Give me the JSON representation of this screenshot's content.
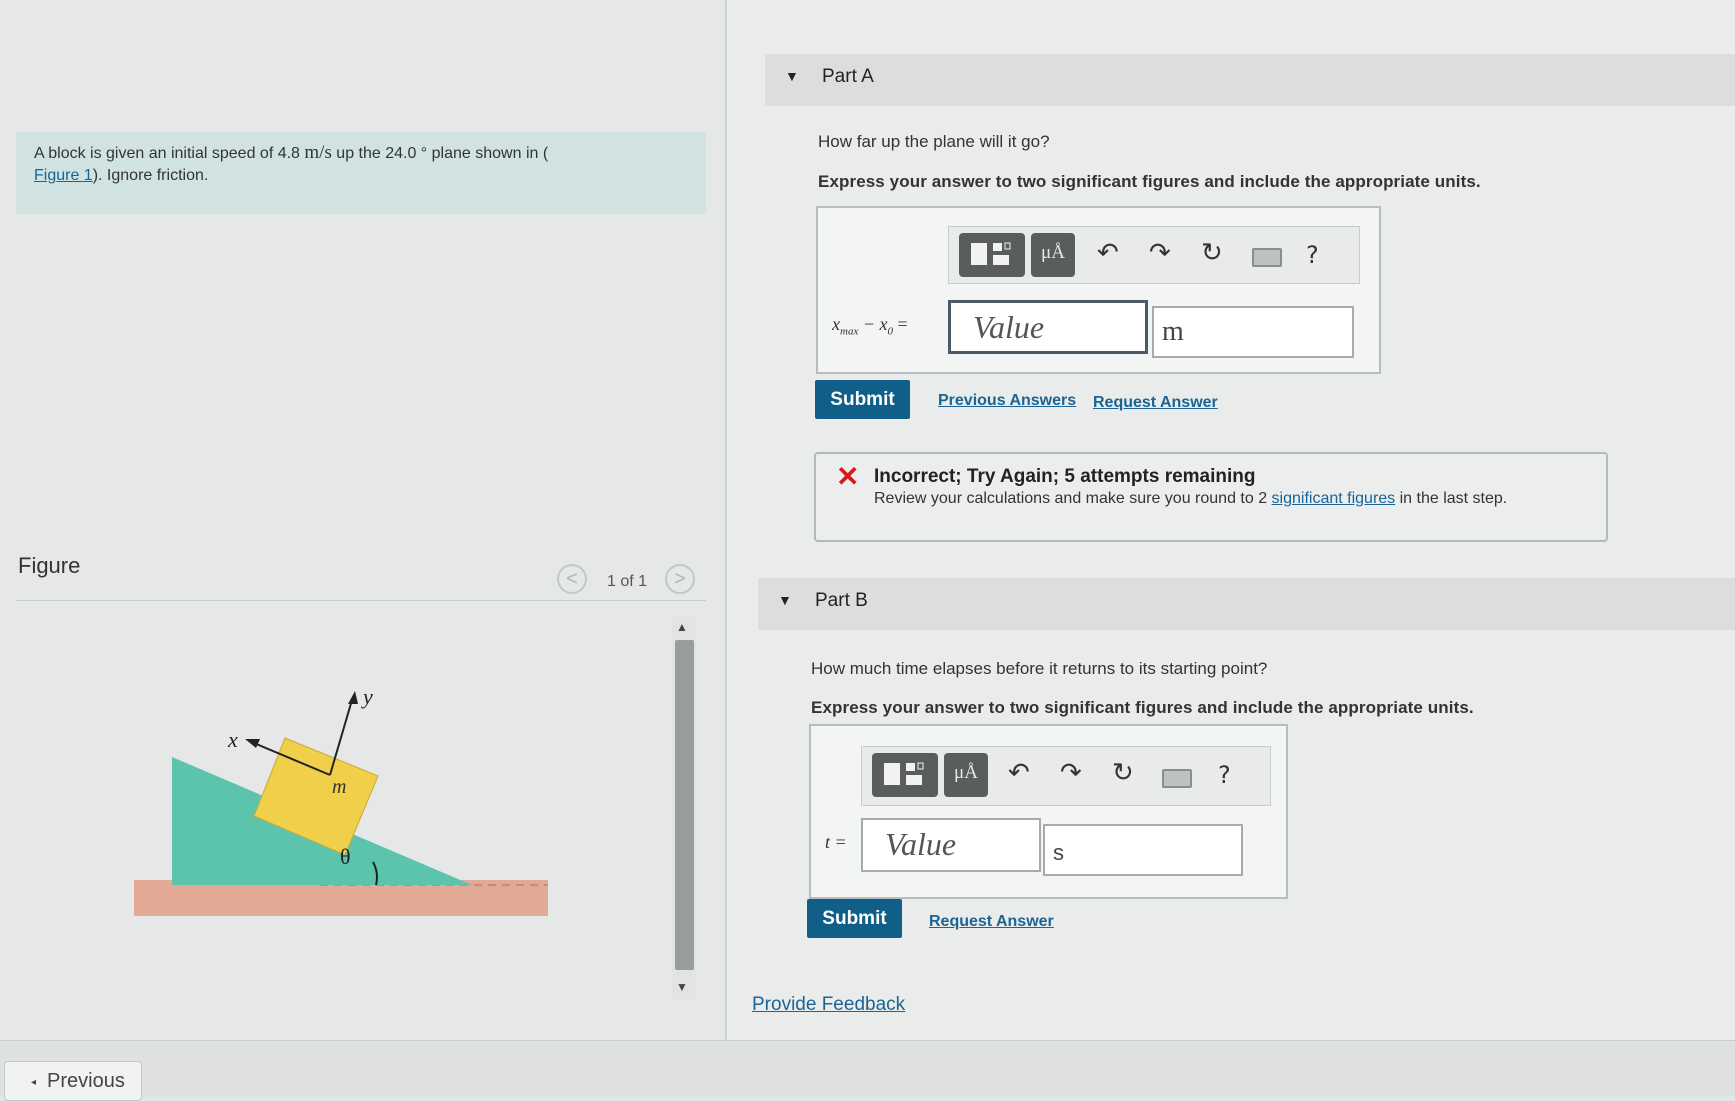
{
  "problem": {
    "text_before": "A block is given an initial speed of 4.8 ",
    "speed_unit": "m/s",
    "text_mid": " up the 24.0 ° plane shown in (",
    "figure_link": "Figure 1",
    "text_after": "). Ignore friction."
  },
  "figure": {
    "title": "Figure",
    "pager": "1 of 1",
    "prev_glyph": "<",
    "next_glyph": ">",
    "label_x": "x",
    "label_y": "y",
    "label_m": "m",
    "label_theta": "θ"
  },
  "part_a": {
    "header": "Part A",
    "question": "How far up the plane will it go?",
    "instruction": "Express your answer to two significant figures and include the appropriate units.",
    "var_label": "x",
    "var_sub_max": "max",
    "var_minus": " − ",
    "var_x0": "x",
    "var_sub_0": "0",
    "var_eq": " =",
    "value_placeholder": "Value",
    "unit_value": "m",
    "submit": "Submit",
    "previous_answers": "Previous Answers",
    "request_answer": "Request Answer",
    "feedback": {
      "icon": "✕",
      "title": "Incorrect; Try Again; 5 attempts remaining",
      "message_before": "Review your calculations and make sure you round to 2 ",
      "message_link": "significant figures",
      "message_after": " in the last step."
    }
  },
  "part_b": {
    "header": "Part B",
    "question": "How much time elapses before it returns to its starting point?",
    "instruction": "Express your answer to two significant figures and include the appropriate units.",
    "var_label": "t =",
    "value_placeholder": "Value",
    "unit_value": "s",
    "submit": "Submit",
    "request_answer": "Request Answer"
  },
  "toolbar": {
    "mu_label": "μÅ",
    "undo_glyph": "↶",
    "redo_glyph": "↷",
    "reset_glyph": "↻",
    "help_glyph": "?"
  },
  "footer": {
    "provide_feedback": "Provide Feedback",
    "previous_button": "Previous",
    "previous_glyph": "◂"
  },
  "colors": {
    "problem_bg": "#d1e3e1",
    "submit_bg": "#0f5f89",
    "link": "#1a6496",
    "error": "#d21c1c",
    "incline": "#5cc4ad",
    "block": "#f0d04a",
    "ground": "#e2a994"
  }
}
